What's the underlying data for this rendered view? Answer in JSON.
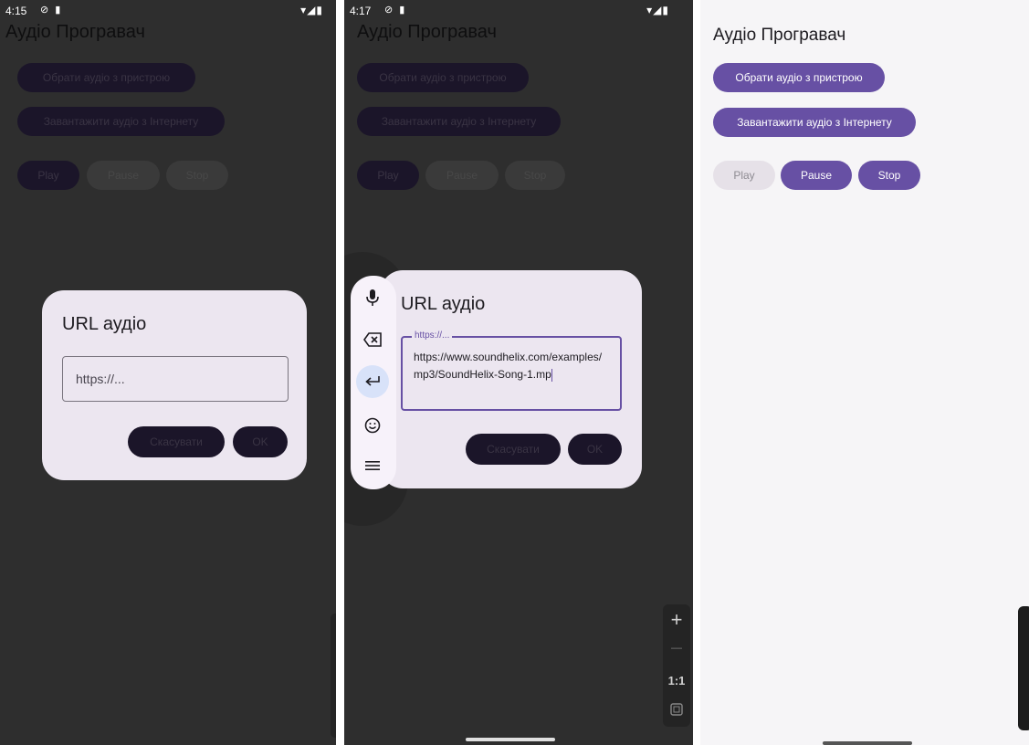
{
  "screens": [
    {
      "status": {
        "time": "4:15",
        "left_icons": "⊘ ▮",
        "right_icons": "▾◢▮"
      },
      "app_title": "Аудіо Програвач",
      "buttons": {
        "pick": "Обрати аудіо з пристрою",
        "download": "Завантажити аудіо з Інтернету",
        "play": "Play",
        "pause": "Pause",
        "stop": "Stop"
      },
      "dialog": {
        "title": "URL аудіо",
        "placeholder": "https://...",
        "cancel": "Скасувати",
        "ok": "OK"
      }
    },
    {
      "status": {
        "time": "4:17",
        "left_icons": "⊘ ▮",
        "right_icons": "▾◢▮"
      },
      "app_title": "Аудіо Програвач",
      "buttons": {
        "pick": "Обрати аудіо з пристрою",
        "download": "Завантажити аудіо з Інтернету",
        "play": "Play",
        "pause": "Pause",
        "stop": "Stop"
      },
      "dialog": {
        "title": "URL аудіо",
        "label": "https://...",
        "value": "https://www.soundhelix.com/examples/mp3/SoundHelix-Song-1.mp",
        "cancel": "Скасувати",
        "ok": "OK"
      },
      "keyboard_toolbar": {
        "icons": [
          "mic-icon",
          "backspace-icon",
          "enter-icon",
          "emoji-icon",
          "menu-icon"
        ]
      },
      "zoom_controls": {
        "zoom_in": "+",
        "zoom_out": "—",
        "ratio": "1:1"
      }
    },
    {
      "app_title": "Аудіо Програвач",
      "buttons": {
        "pick": "Обрати аудіо з пристрою",
        "download": "Завантажити аудіо з Інтернету",
        "play": "Play",
        "pause": "Pause",
        "stop": "Stop"
      },
      "play_enabled": false
    }
  ],
  "colors": {
    "primary": "#6750a4",
    "surface": "#ece6f0",
    "scrim_bg": "#2e2e2e",
    "light_bg": "#f6f5f7"
  }
}
